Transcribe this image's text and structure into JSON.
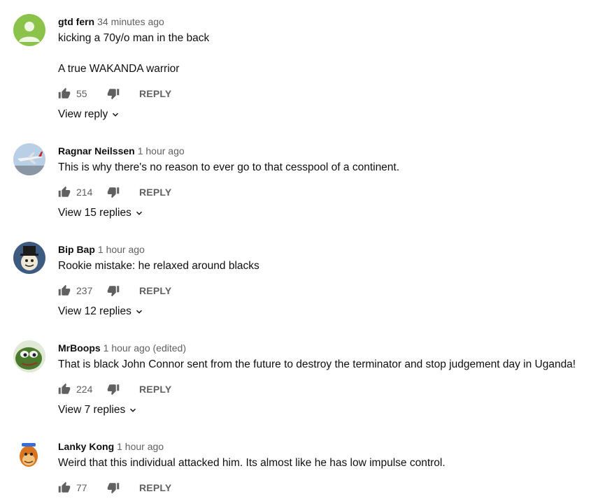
{
  "colors": {
    "icon": "#606060",
    "text": "#0f0f0f",
    "meta": "#606060"
  },
  "comments": [
    {
      "author": "gtd fern",
      "time": "34 minutes ago",
      "edited": "",
      "lines": [
        "kicking a 70y/o man in the back",
        "A true WAKANDA warrior"
      ],
      "likes": "55",
      "reply_label": "REPLY",
      "view_replies": "View reply",
      "avatar_icon": "default-person-avatar"
    },
    {
      "author": "Ragnar Neilssen",
      "time": "1 hour ago",
      "edited": "",
      "lines": [
        "This is why there's no reason to ever go to that cesspool of a continent."
      ],
      "likes": "214",
      "reply_label": "REPLY",
      "view_replies": "View 15 replies",
      "avatar_icon": "airplane-avatar"
    },
    {
      "author": "Bip Bap",
      "time": "1 hour ago",
      "edited": "",
      "lines": [
        "Rookie mistake: he relaxed around blacks"
      ],
      "likes": "237",
      "reply_label": "REPLY",
      "view_replies": "View 12 replies",
      "avatar_icon": "top-hat-character-avatar"
    },
    {
      "author": "MrBoops",
      "time": "1 hour ago",
      "edited": "(edited)",
      "lines": [
        "That is black John Connor sent from the future to destroy the terminator and stop judgement day in Uganda!"
      ],
      "likes": "224",
      "reply_label": "REPLY",
      "view_replies": "View 7 replies",
      "avatar_icon": "green-frog-avatar"
    },
    {
      "author": "Lanky Kong",
      "time": "1 hour ago",
      "edited": "",
      "lines": [
        "Weird that this individual attacked him. Its almost like he has low impulse control."
      ],
      "likes": "77",
      "reply_label": "REPLY",
      "view_replies": "",
      "avatar_icon": "orange-ape-avatar"
    }
  ]
}
